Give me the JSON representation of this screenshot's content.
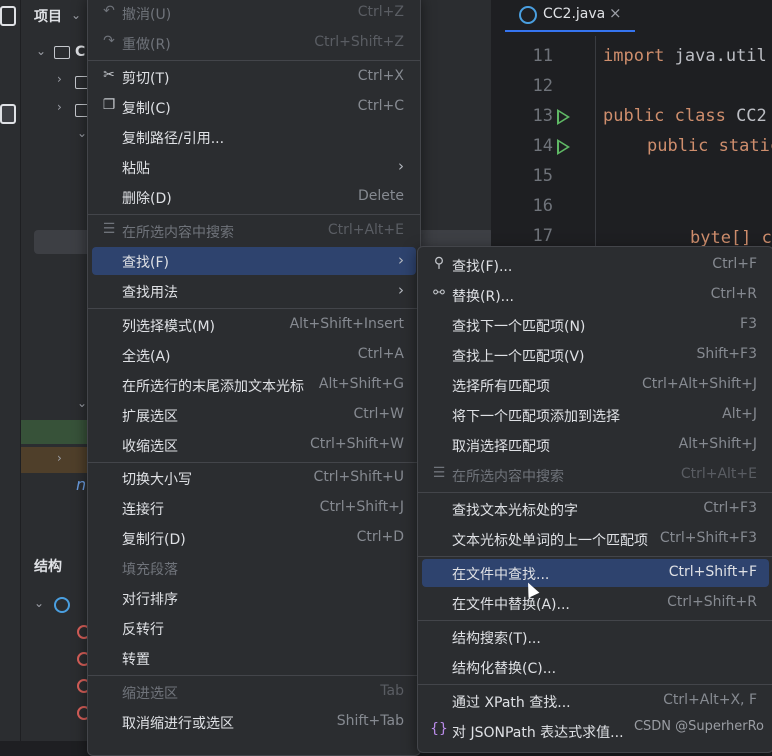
{
  "project": {
    "title": "项目",
    "root_label": "C",
    "structure_title": "结构",
    "node_n": "n"
  },
  "editor": {
    "tab_label": "CC2.java",
    "tab_close": "×",
    "line_numbers": [
      "11",
      "12",
      "13",
      "14",
      "15",
      "16",
      "17"
    ],
    "code": {
      "line11_kw": "import",
      "line11_rest": " java.util",
      "line13_kw": "public class",
      "line13_rest": " CC2",
      "line14_kw": "public static",
      "line17_text": "byte[] c"
    }
  },
  "menu1": {
    "undo": {
      "label": "撤消(U)",
      "shortcut": "Ctrl+Z"
    },
    "redo": {
      "label": "重做(R)",
      "shortcut": "Ctrl+Shift+Z"
    },
    "cut": {
      "label": "剪切(T)",
      "shortcut": "Ctrl+X"
    },
    "copy": {
      "label": "复制(C)",
      "shortcut": "Ctrl+C"
    },
    "copy_path": {
      "label": "复制路径/引用..."
    },
    "paste": {
      "label": "粘贴",
      "arrow": "›"
    },
    "delete": {
      "label": "删除(D)",
      "shortcut": "Delete"
    },
    "search_in_selection": {
      "label": "在所选内容中搜索",
      "shortcut": "Ctrl+Alt+E"
    },
    "find": {
      "label": "查找(F)",
      "arrow": "›"
    },
    "find_usages": {
      "label": "查找用法",
      "arrow": "›"
    },
    "column_select": {
      "label": "列选择模式(M)",
      "shortcut": "Alt+Shift+Insert"
    },
    "select_all": {
      "label": "全选(A)",
      "shortcut": "Ctrl+A"
    },
    "add_carets": {
      "label": "在所选行的末尾添加文本光标",
      "shortcut": "Alt+Shift+G"
    },
    "extend_selection": {
      "label": "扩展选区",
      "shortcut": "Ctrl+W"
    },
    "shrink_selection": {
      "label": "收缩选区",
      "shortcut": "Ctrl+Shift+W"
    },
    "toggle_case": {
      "label": "切换大小写",
      "shortcut": "Ctrl+Shift+U"
    },
    "join_lines": {
      "label": "连接行",
      "shortcut": "Ctrl+Shift+J"
    },
    "duplicate_line": {
      "label": "复制行(D)",
      "shortcut": "Ctrl+D"
    },
    "fill_paragraph": {
      "label": "填充段落"
    },
    "sort_lines": {
      "label": "对行排序"
    },
    "reverse_lines": {
      "label": "反转行"
    },
    "transpose": {
      "label": "转置"
    },
    "indent_selection": {
      "label": "缩进选区",
      "shortcut": "Tab"
    },
    "unindent": {
      "label": "取消缩进行或选区",
      "shortcut": "Shift+Tab"
    }
  },
  "menu2": {
    "find": {
      "label": "查找(F)...",
      "shortcut": "Ctrl+F"
    },
    "replace": {
      "label": "替换(R)...",
      "shortcut": "Ctrl+R"
    },
    "find_next": {
      "label": "查找下一个匹配项(N)",
      "shortcut": "F3"
    },
    "find_prev": {
      "label": "查找上一个匹配项(V)",
      "shortcut": "Shift+F3"
    },
    "select_all_occ": {
      "label": "选择所有匹配项",
      "shortcut": "Ctrl+Alt+Shift+J"
    },
    "add_next_occ": {
      "label": "将下一个匹配项添加到选择",
      "shortcut": "Alt+J"
    },
    "unselect_occ": {
      "label": "取消选择匹配项",
      "shortcut": "Alt+Shift+J"
    },
    "search_in_selection": {
      "label": "在所选内容中搜索",
      "shortcut": "Ctrl+Alt+E"
    },
    "find_word_at_caret": {
      "label": "查找文本光标处的字",
      "shortcut": "Ctrl+F3"
    },
    "find_prev_word": {
      "label": "文本光标处单词的上一个匹配项",
      "shortcut": "Ctrl+Shift+F3"
    },
    "find_in_files": {
      "label": "在文件中查找...",
      "shortcut": "Ctrl+Shift+F"
    },
    "replace_in_files": {
      "label": "在文件中替换(A)...",
      "shortcut": "Ctrl+Shift+R"
    },
    "structural_search": {
      "label": "结构搜索(T)..."
    },
    "structural_replace": {
      "label": "结构化替换(C)..."
    },
    "xpath": {
      "label": "通过 XPath 查找...",
      "shortcut": "Ctrl+Alt+X, F"
    },
    "jsonpath": {
      "label": "对 JSONPath 表达式求值..."
    }
  },
  "watermark": "CSDN @SuperherRo"
}
